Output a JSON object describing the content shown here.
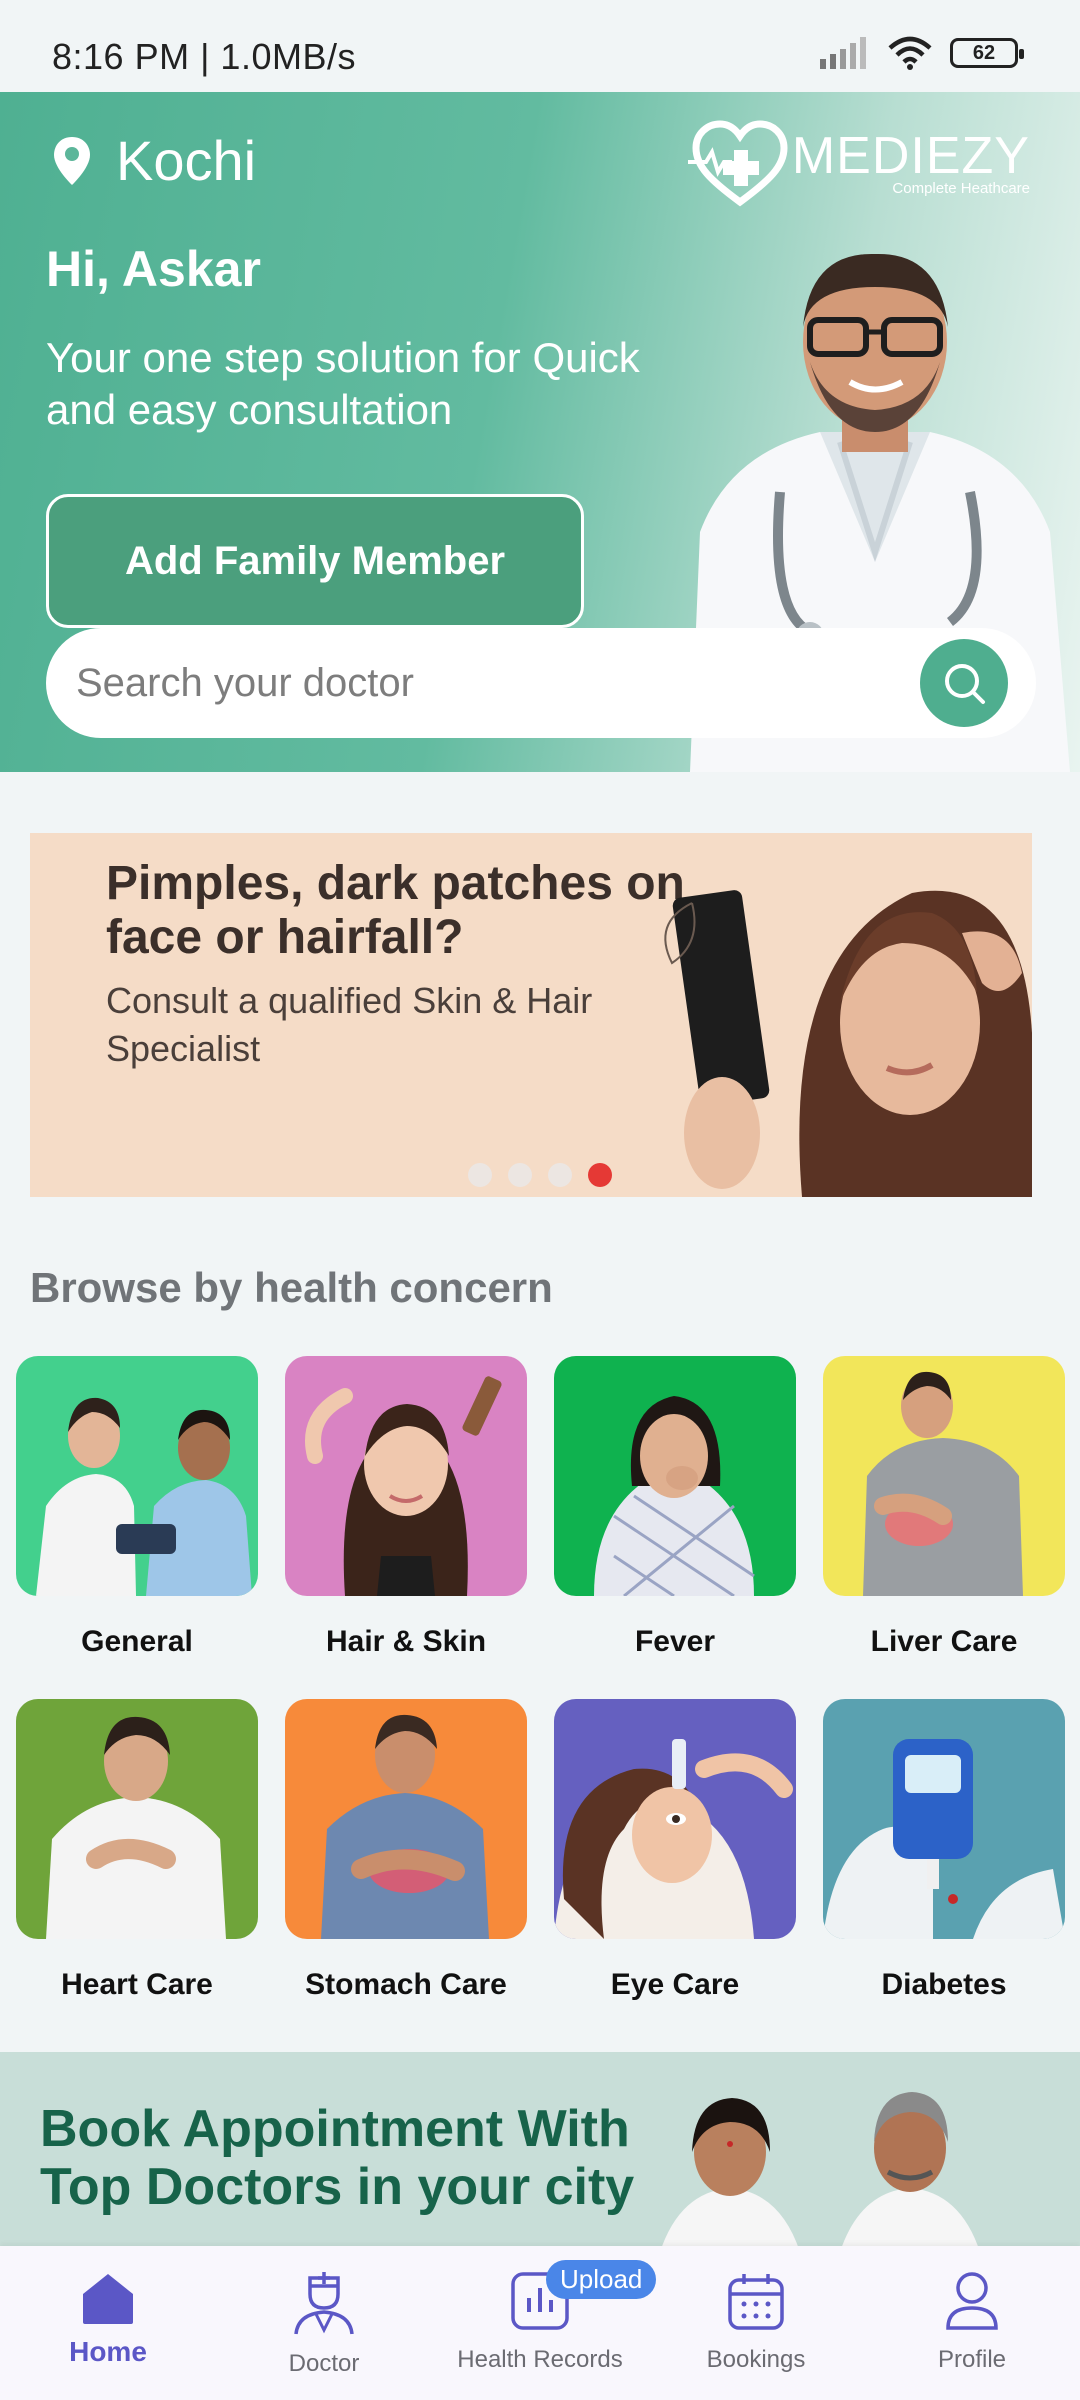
{
  "status_bar": {
    "time": "8:16 PM | 1.0MB/s",
    "battery": "62"
  },
  "header": {
    "location": "Kochi",
    "logo_name": "MEDIEZY",
    "logo_tagline": "Complete Heathcare",
    "greeting": "Hi, Askar",
    "tagline": "Your one step solution for Quick and easy consultation",
    "add_family_label": "Add Family Member",
    "search_placeholder": "Search your doctor"
  },
  "promo": {
    "title": "Pimples, dark patches on face or hairfall?",
    "subtitle": "Consult a qualified Skin & Hair Specialist",
    "slide_count": 4,
    "active_slide": 4
  },
  "health_concerns": {
    "title": "Browse by health concern",
    "items": [
      {
        "label": "General",
        "color": "#43d08d"
      },
      {
        "label": "Hair & Skin",
        "color": "#d983c3"
      },
      {
        "label": "Fever",
        "color": "#0fb24f"
      },
      {
        "label": "Liver Care",
        "color": "#f2e65a"
      },
      {
        "label": "Heart Care",
        "color": "#6fa43a"
      },
      {
        "label": "Stomach Care",
        "color": "#f78a3a"
      },
      {
        "label": "Eye Care",
        "color": "#6560c0"
      },
      {
        "label": "Diabetes",
        "color": "#5aa1b0"
      }
    ]
  },
  "appointment_banner": {
    "title": "Book Appointment With Top Doctors in your city"
  },
  "bottom_nav": {
    "items": [
      {
        "label": "Home",
        "icon": "home-icon",
        "active": true
      },
      {
        "label": "Doctor",
        "icon": "doctor-icon"
      },
      {
        "label": "Health Records",
        "icon": "health-records-icon",
        "badge": "Upload"
      },
      {
        "label": "Bookings",
        "icon": "calendar-icon"
      },
      {
        "label": "Profile",
        "icon": "profile-icon"
      }
    ]
  },
  "colors": {
    "primary": "#4fae8f",
    "nav_active": "#5b57c6",
    "promo_bg": "#f5dcc7",
    "dot_active": "#e53935"
  }
}
